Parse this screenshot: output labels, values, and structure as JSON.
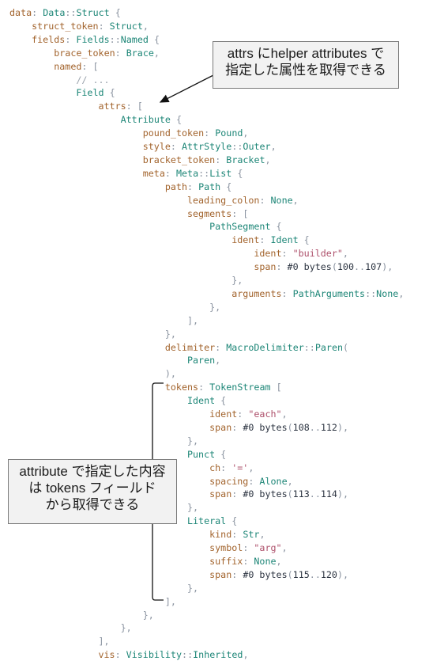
{
  "code_lines": [
    {
      "indent": 0,
      "tokens": [
        {
          "k": "f",
          "t": "data"
        },
        {
          "k": "p",
          "t": ": "
        },
        {
          "k": "t",
          "t": "Data"
        },
        {
          "k": "p",
          "t": "::"
        },
        {
          "k": "t",
          "t": "Struct"
        },
        {
          "k": "p",
          "t": " {"
        }
      ]
    },
    {
      "indent": 4,
      "tokens": [
        {
          "k": "f",
          "t": "struct_token"
        },
        {
          "k": "p",
          "t": ": "
        },
        {
          "k": "t",
          "t": "Struct"
        },
        {
          "k": "p",
          "t": ","
        }
      ]
    },
    {
      "indent": 4,
      "tokens": [
        {
          "k": "f",
          "t": "fields"
        },
        {
          "k": "p",
          "t": ": "
        },
        {
          "k": "t",
          "t": "Fields"
        },
        {
          "k": "p",
          "t": "::"
        },
        {
          "k": "t",
          "t": "Named"
        },
        {
          "k": "p",
          "t": " {"
        }
      ]
    },
    {
      "indent": 8,
      "tokens": [
        {
          "k": "f",
          "t": "brace_token"
        },
        {
          "k": "p",
          "t": ": "
        },
        {
          "k": "t",
          "t": "Brace"
        },
        {
          "k": "p",
          "t": ","
        }
      ]
    },
    {
      "indent": 8,
      "tokens": [
        {
          "k": "f",
          "t": "named"
        },
        {
          "k": "p",
          "t": ": ["
        }
      ]
    },
    {
      "indent": 12,
      "tokens": [
        {
          "k": "c",
          "t": "// ..."
        }
      ]
    },
    {
      "indent": 12,
      "tokens": [
        {
          "k": "t",
          "t": "Field"
        },
        {
          "k": "p",
          "t": " {"
        }
      ]
    },
    {
      "indent": 16,
      "tokens": [
        {
          "k": "f",
          "t": "attrs"
        },
        {
          "k": "p",
          "t": ": ["
        }
      ]
    },
    {
      "indent": 20,
      "tokens": [
        {
          "k": "t",
          "t": "Attribute"
        },
        {
          "k": "p",
          "t": " {"
        }
      ]
    },
    {
      "indent": 24,
      "tokens": [
        {
          "k": "f",
          "t": "pound_token"
        },
        {
          "k": "p",
          "t": ": "
        },
        {
          "k": "t",
          "t": "Pound"
        },
        {
          "k": "p",
          "t": ","
        }
      ]
    },
    {
      "indent": 24,
      "tokens": [
        {
          "k": "f",
          "t": "style"
        },
        {
          "k": "p",
          "t": ": "
        },
        {
          "k": "t",
          "t": "AttrStyle"
        },
        {
          "k": "p",
          "t": "::"
        },
        {
          "k": "t",
          "t": "Outer"
        },
        {
          "k": "p",
          "t": ","
        }
      ]
    },
    {
      "indent": 24,
      "tokens": [
        {
          "k": "f",
          "t": "bracket_token"
        },
        {
          "k": "p",
          "t": ": "
        },
        {
          "k": "t",
          "t": "Bracket"
        },
        {
          "k": "p",
          "t": ","
        }
      ]
    },
    {
      "indent": 24,
      "tokens": [
        {
          "k": "f",
          "t": "meta"
        },
        {
          "k": "p",
          "t": ": "
        },
        {
          "k": "t",
          "t": "Meta"
        },
        {
          "k": "p",
          "t": "::"
        },
        {
          "k": "t",
          "t": "List"
        },
        {
          "k": "p",
          "t": " {"
        }
      ]
    },
    {
      "indent": 28,
      "tokens": [
        {
          "k": "f",
          "t": "path"
        },
        {
          "k": "p",
          "t": ": "
        },
        {
          "k": "t",
          "t": "Path"
        },
        {
          "k": "p",
          "t": " {"
        }
      ]
    },
    {
      "indent": 32,
      "tokens": [
        {
          "k": "f",
          "t": "leading_colon"
        },
        {
          "k": "p",
          "t": ": "
        },
        {
          "k": "t",
          "t": "None"
        },
        {
          "k": "p",
          "t": ","
        }
      ]
    },
    {
      "indent": 32,
      "tokens": [
        {
          "k": "f",
          "t": "segments"
        },
        {
          "k": "p",
          "t": ": ["
        }
      ]
    },
    {
      "indent": 36,
      "tokens": [
        {
          "k": "t",
          "t": "PathSegment"
        },
        {
          "k": "p",
          "t": " {"
        }
      ]
    },
    {
      "indent": 40,
      "tokens": [
        {
          "k": "f",
          "t": "ident"
        },
        {
          "k": "p",
          "t": ": "
        },
        {
          "k": "t",
          "t": "Ident"
        },
        {
          "k": "p",
          "t": " {"
        }
      ]
    },
    {
      "indent": 44,
      "tokens": [
        {
          "k": "f",
          "t": "ident"
        },
        {
          "k": "p",
          "t": ": "
        },
        {
          "k": "s",
          "t": "\"builder\""
        },
        {
          "k": "p",
          "t": ","
        }
      ]
    },
    {
      "indent": 44,
      "tokens": [
        {
          "k": "f",
          "t": "span"
        },
        {
          "k": "p",
          "t": ": "
        },
        {
          "k": "n",
          "t": "#0 bytes"
        },
        {
          "k": "p",
          "t": "("
        },
        {
          "k": "n",
          "t": "100"
        },
        {
          "k": "p",
          "t": ".."
        },
        {
          "k": "n",
          "t": "107"
        },
        {
          "k": "p",
          "t": "),"
        }
      ]
    },
    {
      "indent": 40,
      "tokens": [
        {
          "k": "p",
          "t": "},"
        }
      ]
    },
    {
      "indent": 40,
      "tokens": [
        {
          "k": "f",
          "t": "arguments"
        },
        {
          "k": "p",
          "t": ": "
        },
        {
          "k": "t",
          "t": "PathArguments"
        },
        {
          "k": "p",
          "t": "::"
        },
        {
          "k": "t",
          "t": "None"
        },
        {
          "k": "p",
          "t": ","
        }
      ]
    },
    {
      "indent": 36,
      "tokens": [
        {
          "k": "p",
          "t": "},"
        }
      ]
    },
    {
      "indent": 32,
      "tokens": [
        {
          "k": "p",
          "t": "],"
        }
      ]
    },
    {
      "indent": 28,
      "tokens": [
        {
          "k": "p",
          "t": "},"
        }
      ]
    },
    {
      "indent": 28,
      "tokens": [
        {
          "k": "f",
          "t": "delimiter"
        },
        {
          "k": "p",
          "t": ": "
        },
        {
          "k": "t",
          "t": "MacroDelimiter"
        },
        {
          "k": "p",
          "t": "::"
        },
        {
          "k": "t",
          "t": "Paren"
        },
        {
          "k": "p",
          "t": "("
        }
      ]
    },
    {
      "indent": 32,
      "tokens": [
        {
          "k": "t",
          "t": "Paren"
        },
        {
          "k": "p",
          "t": ","
        }
      ]
    },
    {
      "indent": 28,
      "tokens": [
        {
          "k": "p",
          "t": "),"
        }
      ]
    },
    {
      "indent": 28,
      "tokens": [
        {
          "k": "f",
          "t": "tokens"
        },
        {
          "k": "p",
          "t": ": "
        },
        {
          "k": "t",
          "t": "TokenStream"
        },
        {
          "k": "p",
          "t": " ["
        }
      ]
    },
    {
      "indent": 32,
      "tokens": [
        {
          "k": "t",
          "t": "Ident"
        },
        {
          "k": "p",
          "t": " {"
        }
      ]
    },
    {
      "indent": 36,
      "tokens": [
        {
          "k": "f",
          "t": "ident"
        },
        {
          "k": "p",
          "t": ": "
        },
        {
          "k": "s",
          "t": "\"each\""
        },
        {
          "k": "p",
          "t": ","
        }
      ]
    },
    {
      "indent": 36,
      "tokens": [
        {
          "k": "f",
          "t": "span"
        },
        {
          "k": "p",
          "t": ": "
        },
        {
          "k": "n",
          "t": "#0 bytes"
        },
        {
          "k": "p",
          "t": "("
        },
        {
          "k": "n",
          "t": "108"
        },
        {
          "k": "p",
          "t": ".."
        },
        {
          "k": "n",
          "t": "112"
        },
        {
          "k": "p",
          "t": "),"
        }
      ]
    },
    {
      "indent": 32,
      "tokens": [
        {
          "k": "p",
          "t": "},"
        }
      ]
    },
    {
      "indent": 32,
      "tokens": [
        {
          "k": "t",
          "t": "Punct"
        },
        {
          "k": "p",
          "t": " {"
        }
      ]
    },
    {
      "indent": 36,
      "tokens": [
        {
          "k": "f",
          "t": "ch"
        },
        {
          "k": "p",
          "t": ": "
        },
        {
          "k": "s",
          "t": "'='"
        },
        {
          "k": "p",
          "t": ","
        }
      ]
    },
    {
      "indent": 36,
      "tokens": [
        {
          "k": "f",
          "t": "spacing"
        },
        {
          "k": "p",
          "t": ": "
        },
        {
          "k": "t",
          "t": "Alone"
        },
        {
          "k": "p",
          "t": ","
        }
      ]
    },
    {
      "indent": 36,
      "tokens": [
        {
          "k": "f",
          "t": "span"
        },
        {
          "k": "p",
          "t": ": "
        },
        {
          "k": "n",
          "t": "#0 bytes"
        },
        {
          "k": "p",
          "t": "("
        },
        {
          "k": "n",
          "t": "113"
        },
        {
          "k": "p",
          "t": ".."
        },
        {
          "k": "n",
          "t": "114"
        },
        {
          "k": "p",
          "t": "),"
        }
      ]
    },
    {
      "indent": 32,
      "tokens": [
        {
          "k": "p",
          "t": "},"
        }
      ]
    },
    {
      "indent": 32,
      "tokens": [
        {
          "k": "t",
          "t": "Literal"
        },
        {
          "k": "p",
          "t": " {"
        }
      ]
    },
    {
      "indent": 36,
      "tokens": [
        {
          "k": "f",
          "t": "kind"
        },
        {
          "k": "p",
          "t": ": "
        },
        {
          "k": "t",
          "t": "Str"
        },
        {
          "k": "p",
          "t": ","
        }
      ]
    },
    {
      "indent": 36,
      "tokens": [
        {
          "k": "f",
          "t": "symbol"
        },
        {
          "k": "p",
          "t": ": "
        },
        {
          "k": "s",
          "t": "\"arg\""
        },
        {
          "k": "p",
          "t": ","
        }
      ]
    },
    {
      "indent": 36,
      "tokens": [
        {
          "k": "f",
          "t": "suffix"
        },
        {
          "k": "p",
          "t": ": "
        },
        {
          "k": "t",
          "t": "None"
        },
        {
          "k": "p",
          "t": ","
        }
      ]
    },
    {
      "indent": 36,
      "tokens": [
        {
          "k": "f",
          "t": "span"
        },
        {
          "k": "p",
          "t": ": "
        },
        {
          "k": "n",
          "t": "#0 bytes"
        },
        {
          "k": "p",
          "t": "("
        },
        {
          "k": "n",
          "t": "115"
        },
        {
          "k": "p",
          "t": ".."
        },
        {
          "k": "n",
          "t": "120"
        },
        {
          "k": "p",
          "t": "),"
        }
      ]
    },
    {
      "indent": 32,
      "tokens": [
        {
          "k": "p",
          "t": "},"
        }
      ]
    },
    {
      "indent": 28,
      "tokens": [
        {
          "k": "p",
          "t": "],"
        }
      ]
    },
    {
      "indent": 24,
      "tokens": [
        {
          "k": "p",
          "t": "},"
        }
      ]
    },
    {
      "indent": 20,
      "tokens": [
        {
          "k": "p",
          "t": "},"
        }
      ]
    },
    {
      "indent": 16,
      "tokens": [
        {
          "k": "p",
          "t": "],"
        }
      ]
    },
    {
      "indent": 16,
      "tokens": [
        {
          "k": "f",
          "t": "vis"
        },
        {
          "k": "p",
          "t": ": "
        },
        {
          "k": "t",
          "t": "Visibility"
        },
        {
          "k": "p",
          "t": "::"
        },
        {
          "k": "t",
          "t": "Inherited"
        },
        {
          "k": "p",
          "t": ","
        }
      ]
    }
  ],
  "callout_attrs": {
    "line1": "attrs にhelper attributes で",
    "line2": "指定した属性を取得できる"
  },
  "callout_tokens": {
    "line1": "attribute で指定した内容",
    "line2": "は tokens フィールド",
    "line3": "から取得できる"
  },
  "colors": {
    "field": "#a2632c",
    "type": "#1d8677",
    "string": "#ad4f6a",
    "number": "#2b3340",
    "punct": "#8a93a0",
    "comment": "#9aa2ac",
    "callout_bg": "#f2f2f2"
  }
}
